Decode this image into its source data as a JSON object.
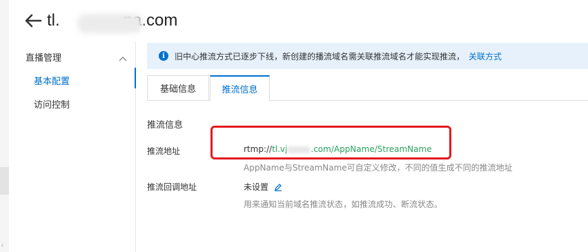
{
  "header": {
    "title": "tl.",
    "title_suffix": "na.com"
  },
  "sidebar": {
    "group_label": "直播管理",
    "items": [
      {
        "label": "基本配置",
        "active": true
      },
      {
        "label": "访问控制",
        "active": false
      }
    ]
  },
  "notice": {
    "text": "旧中心推流方式已逐步下线，新创建的播流域名需关联推流域名才能实现推流，",
    "link": "关联方式"
  },
  "tabs": [
    {
      "label": "基础信息",
      "active": false
    },
    {
      "label": "推流信息",
      "active": true
    }
  ],
  "push_info": {
    "section_title": "推流信息",
    "push_url_label": "推流地址",
    "push_url_prefix": "rtmp://",
    "push_url_host_start": "tl.vj",
    "push_url_path": ".com/AppName/StreamName",
    "push_url_hint": "AppName与StreamName可自定义修改，不同的值生成不同的推流地址",
    "callback_label": "推流回调地址",
    "callback_value": "未设置",
    "callback_hint": "用来通知当前域名推流状态，如推流成功、断流状态。"
  },
  "colors": {
    "accent": "#0070cc",
    "link_green": "#2aa15f",
    "highlight_red": "#e3191e",
    "notice_bg": "#e6f1fb"
  },
  "icons": [
    "back-arrow-icon",
    "chevron-up-icon",
    "info-icon",
    "edit-pencil-icon"
  ]
}
